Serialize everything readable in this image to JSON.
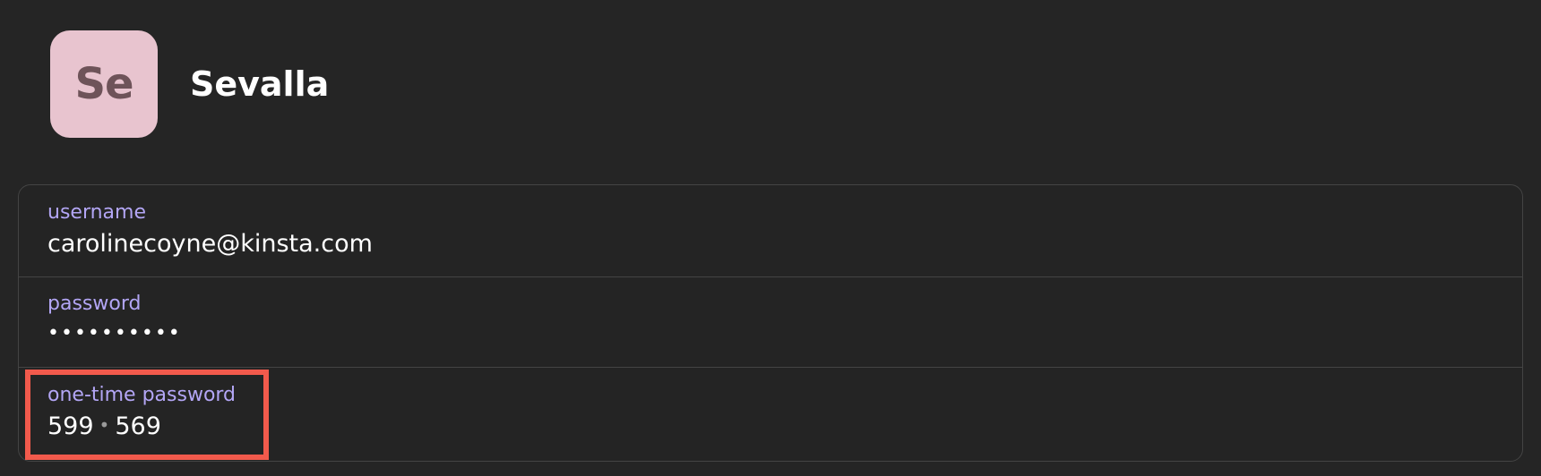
{
  "item": {
    "avatar_initials": "Se",
    "title": "Sevalla"
  },
  "fields": {
    "username": {
      "label": "username",
      "value": "carolinecoyne@kinsta.com"
    },
    "password": {
      "label": "password",
      "value": "••••••••••"
    },
    "otp": {
      "label": "one-time password",
      "part1": "599",
      "separator": "•",
      "part2": "569"
    }
  },
  "colors": {
    "background": "#252525",
    "avatar_bg": "#e8c4cf",
    "avatar_text": "#6e5359",
    "label": "#b3a6f5",
    "highlight": "#f25a4c"
  }
}
